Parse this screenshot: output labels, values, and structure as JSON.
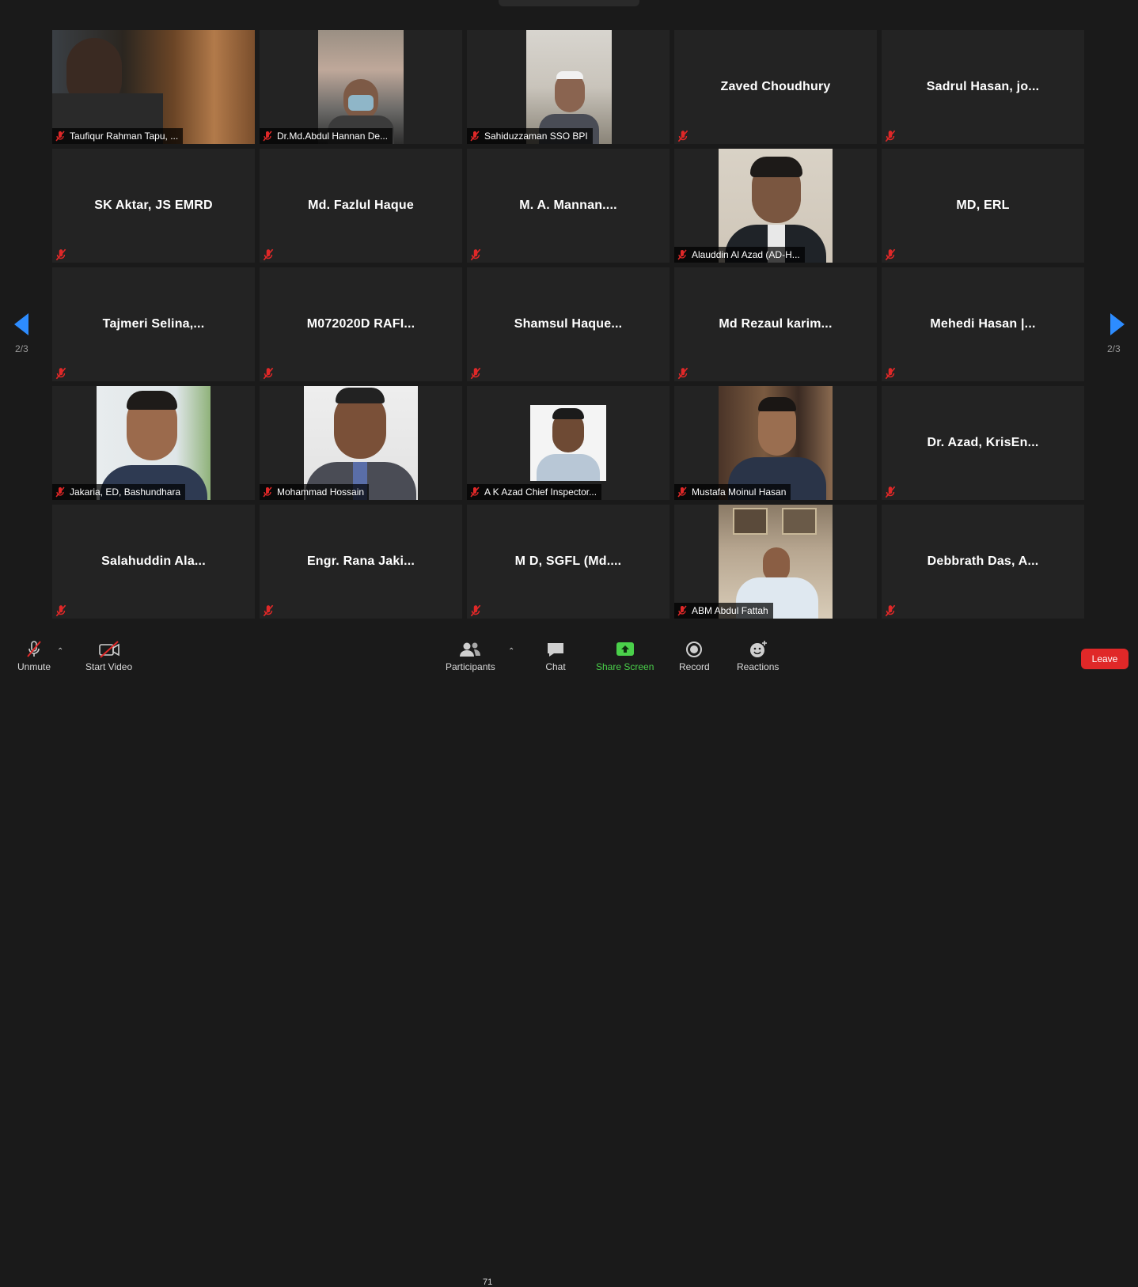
{
  "pager": {
    "left": "2/3",
    "right": "2/3"
  },
  "participants": [
    {
      "name": "Taufiqur Rahman Tapu, ...",
      "video": true
    },
    {
      "name": "Dr.Md.Abdul Hannan De...",
      "video": true
    },
    {
      "name": "Sahiduzzaman SSO BPI",
      "video": true
    },
    {
      "name": "Zaved Choudhury",
      "video": false
    },
    {
      "name": "Sadrul Hasan, jo...",
      "video": false
    },
    {
      "name": "SK Aktar, JS EMRD",
      "video": false
    },
    {
      "name": "Md. Fazlul Haque",
      "video": false
    },
    {
      "name": "M. A. Mannan....",
      "video": false
    },
    {
      "name": "Alauddin Al Azad (AD-H...",
      "video": true
    },
    {
      "name": "MD, ERL",
      "video": false
    },
    {
      "name": "Tajmeri Selina,...",
      "video": false
    },
    {
      "name": "M072020D RAFI...",
      "video": false
    },
    {
      "name": "Shamsul Haque...",
      "video": false
    },
    {
      "name": "Md Rezaul karim...",
      "video": false
    },
    {
      "name": "Mehedi Hasan |...",
      "video": false
    },
    {
      "name": "Jakaria, ED, Bashundhara",
      "video": true
    },
    {
      "name": "Mohammad Hossain",
      "video": true
    },
    {
      "name": "A K Azad Chief Inspector...",
      "video": true
    },
    {
      "name": "Mustafa Moinul Hasan",
      "video": true
    },
    {
      "name": "Dr. Azad, KrisEn...",
      "video": false
    },
    {
      "name": "Salahuddin Ala...",
      "video": false
    },
    {
      "name": "Engr. Rana Jaki...",
      "video": false
    },
    {
      "name": "M D, SGFL (Md....",
      "video": false
    },
    {
      "name": "ABM Abdul Fattah",
      "video": true
    },
    {
      "name": "Debbrath Das, A...",
      "video": false
    }
  ],
  "toolbar": {
    "unmute": "Unmute",
    "start_video": "Start Video",
    "participants": "Participants",
    "participants_count": "71",
    "chat": "Chat",
    "share_screen": "Share Screen",
    "record": "Record",
    "reactions": "Reactions",
    "leave": "Leave"
  },
  "colors": {
    "accent": "#2d8cff",
    "share": "#4ad04a",
    "leave": "#e02828",
    "muted": "#e02828"
  }
}
